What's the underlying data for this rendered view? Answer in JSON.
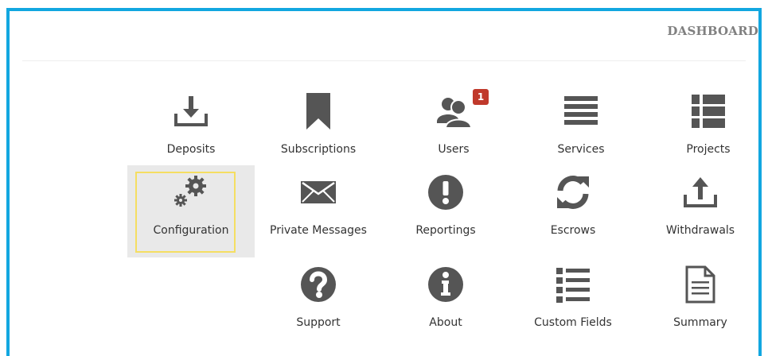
{
  "header": {
    "title": "DASHBOARD"
  },
  "tiles": [
    {
      "id": "deposits",
      "label": "Deposits",
      "icon": "download-icon"
    },
    {
      "id": "subscriptions",
      "label": "Subscriptions",
      "icon": "bookmark-icon"
    },
    {
      "id": "users",
      "label": "Users",
      "icon": "users-icon",
      "badge": "1"
    },
    {
      "id": "services",
      "label": "Services",
      "icon": "list-lines-icon"
    },
    {
      "id": "projects",
      "label": "Projects",
      "icon": "list-blocks-icon"
    },
    {
      "id": "configuration",
      "label": "Configuration",
      "icon": "gears-icon",
      "selected": true
    },
    {
      "id": "private-messages",
      "label": "Private Messages",
      "icon": "envelope-icon"
    },
    {
      "id": "reportings",
      "label": "Reportings",
      "icon": "exclamation-icon"
    },
    {
      "id": "escrows",
      "label": "Escrows",
      "icon": "refresh-icon"
    },
    {
      "id": "withdrawals",
      "label": "Withdrawals",
      "icon": "upload-icon"
    },
    {
      "id": "support",
      "label": "Support",
      "icon": "question-icon"
    },
    {
      "id": "about",
      "label": "About",
      "icon": "info-icon"
    },
    {
      "id": "custom-fields",
      "label": "Custom Fields",
      "icon": "list-ul-icon"
    },
    {
      "id": "summary",
      "label": "Summary",
      "icon": "document-icon"
    }
  ],
  "colors": {
    "accent": "#12a7e0",
    "icon": "#555555",
    "badge": "#c0392b",
    "focus": "#f5de62",
    "selected_bg": "#e9e9e9"
  }
}
